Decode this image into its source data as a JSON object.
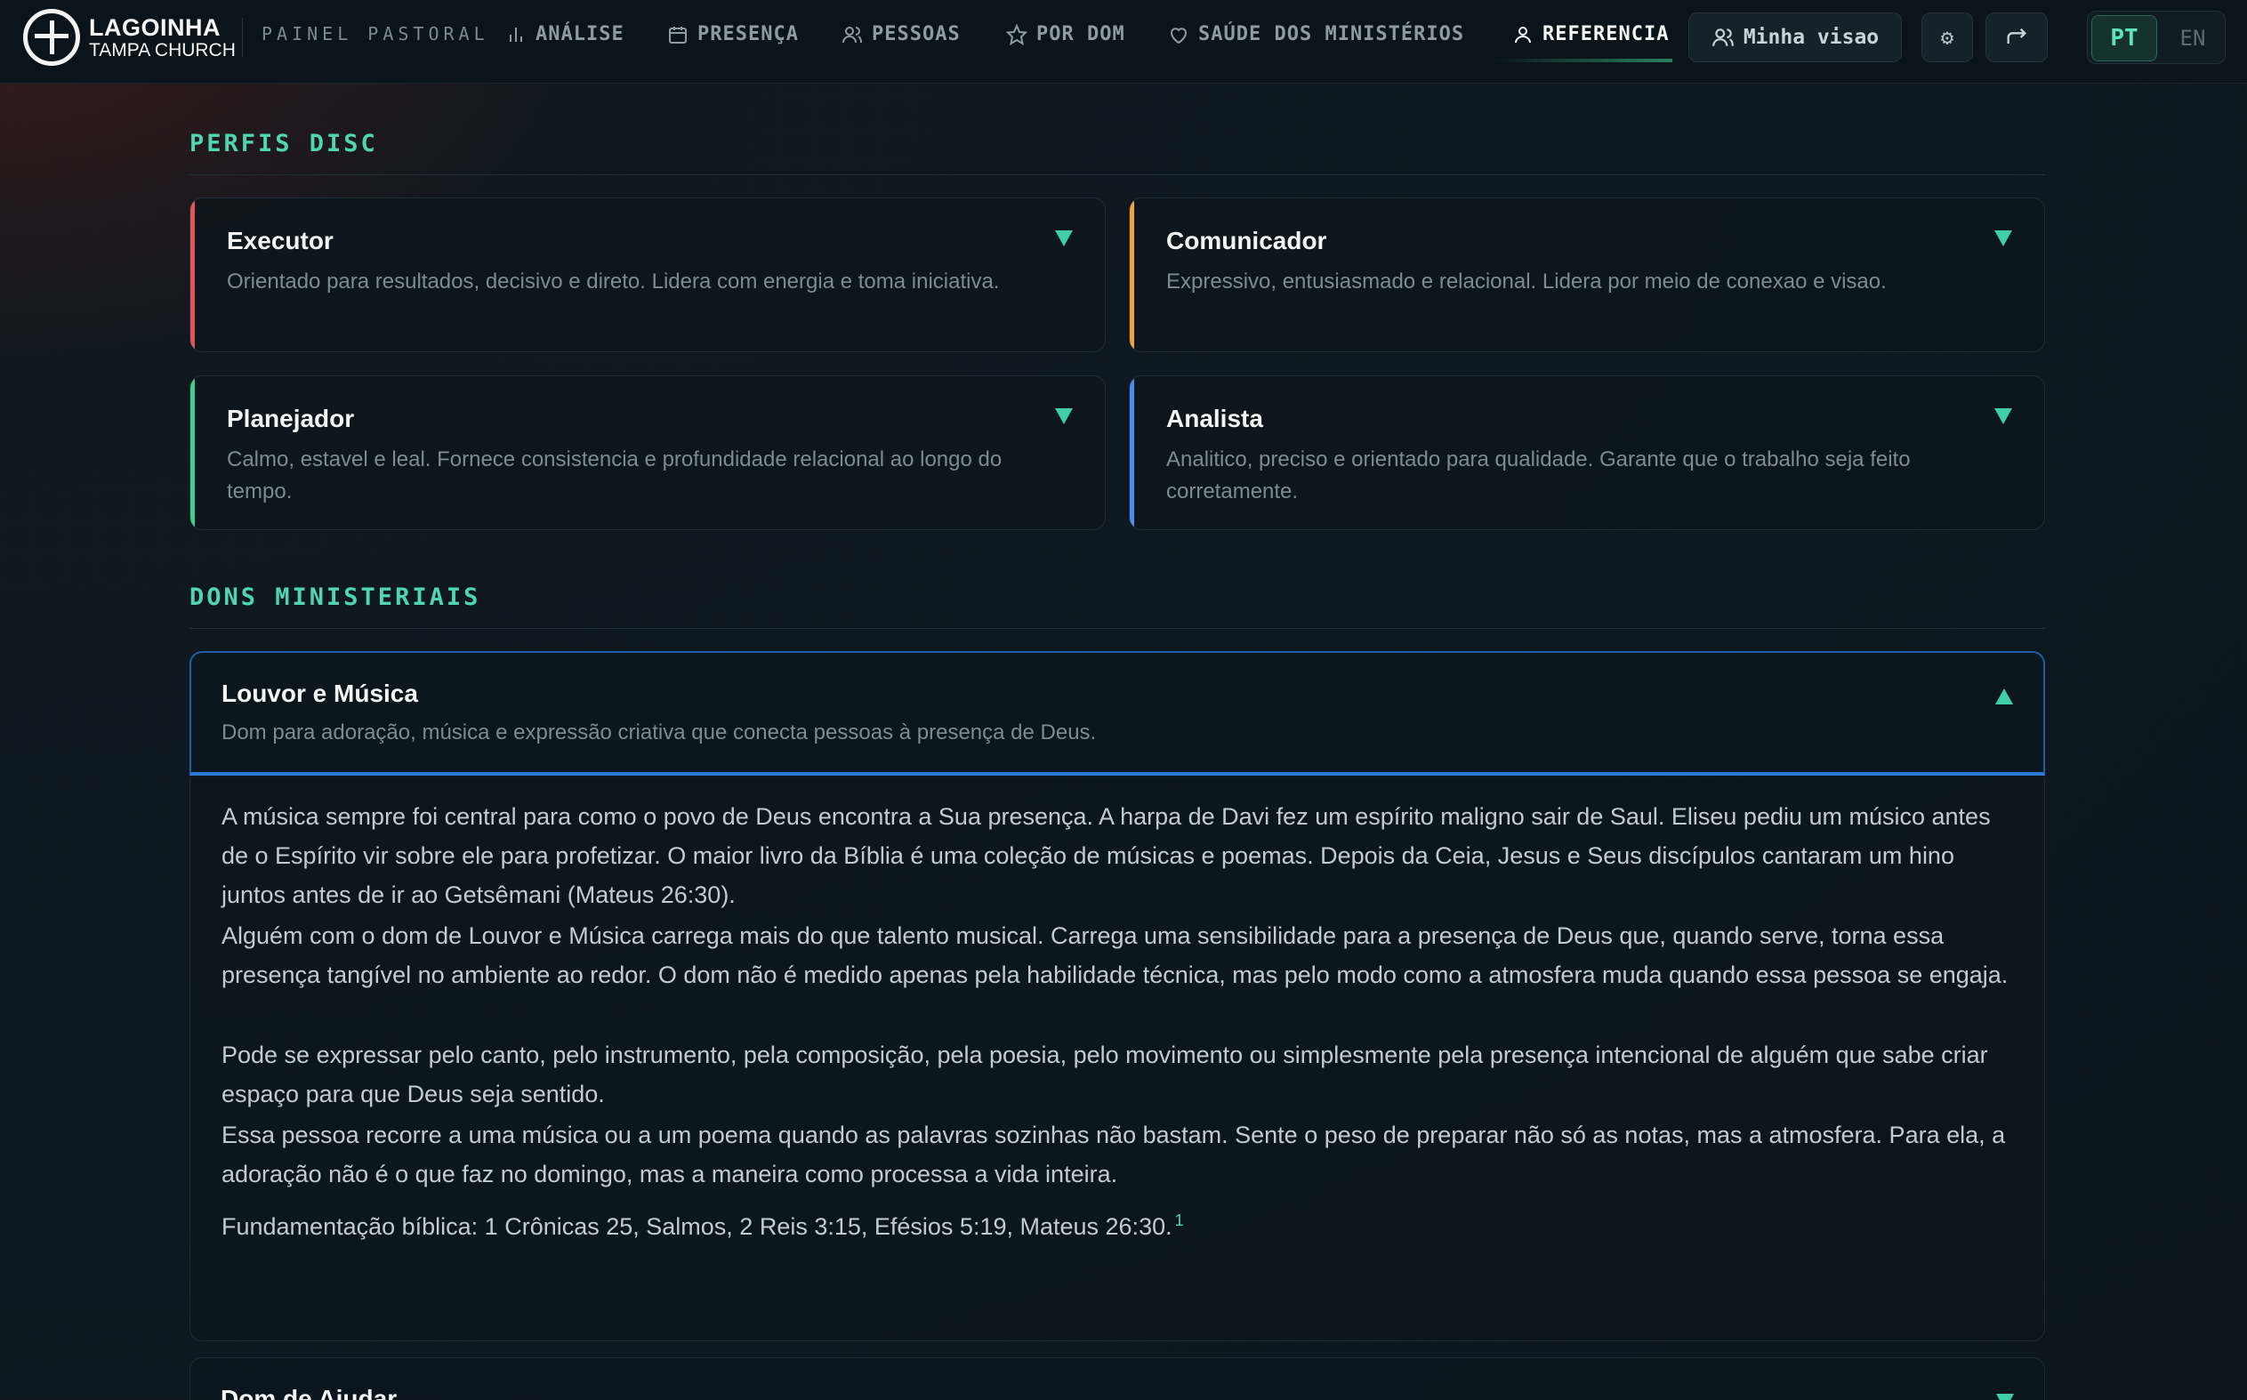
{
  "brand": {
    "name": "LAGOINHA",
    "subtitle": "TAMPA CHURCH"
  },
  "nav": {
    "panel": "PAINEL PASTORAL",
    "items": [
      {
        "label": "ANÁLISE",
        "icon": "bar-chart-icon"
      },
      {
        "label": "PRESENÇA",
        "icon": "calendar-icon"
      },
      {
        "label": "PESSOAS",
        "icon": "people-icon"
      },
      {
        "label": "POR DOM",
        "icon": "star-icon"
      },
      {
        "label": "SAÚDE DOS MINISTÉRIOS",
        "icon": "heart-icon"
      },
      {
        "label": "REFERENCIA",
        "icon": "person-icon",
        "active": true
      }
    ],
    "my_view": "Minha visao",
    "settings_icon": "gear-icon",
    "logout_icon": "logout-icon"
  },
  "lang": {
    "pt": "PT",
    "en": "EN",
    "selected": "PT"
  },
  "disc": {
    "title": "PERFIS DISC",
    "cards": [
      {
        "title": "Executor",
        "description": "Orientado para resultados, decisivo e direto. Lidera com energia e toma iniciativa.",
        "color": "#e2545a"
      },
      {
        "title": "Comunicador",
        "description": "Expressivo, entusiasmado e relacional. Lidera por meio de conexao e visao.",
        "color": "#f0a43a"
      },
      {
        "title": "Planejador",
        "description": "Calmo, estavel e leal. Fornece consistencia e profundidade relacional ao longo do tempo.",
        "color": "#3fcf8e"
      },
      {
        "title": "Analista",
        "description": "Analitico, preciso e orientado para qualidade. Garante que o trabalho seja feito corretamente.",
        "color": "#4a8ef0"
      }
    ]
  },
  "gifts": {
    "title": "DONS MINISTERIAIS",
    "open": {
      "title": "Louvor e Música",
      "description": "Dom para adoração, música e expressão criativa que conecta pessoas à presença de Deus.",
      "paragraphs": [
        "A música sempre foi central para como o povo de Deus encontra a Sua presença. A harpa de Davi fez um espírito maligno sair de Saul. Eliseu pediu um músico antes de o Espírito vir sobre ele para profetizar. O maior livro da Bíblia é uma coleção de músicas e poemas. Depois da Ceia, Jesus e Seus discípulos cantaram um hino juntos antes de ir ao Getsêmani (Mateus 26:30).",
        "Alguém com o dom de Louvor e Música carrega mais do que talento musical. Carrega uma sensibilidade para a presença de Deus que, quando serve, torna essa presença tangível no ambiente ao redor. O dom não é medido apenas pela habilidade técnica, mas pelo modo como a atmosfera muda quando essa pessoa se engaja.",
        "Pode se expressar pelo canto, pelo instrumento, pela composição, pela poesia, pelo movimento ou simplesmente pela presença intencional de alguém que sabe criar espaço para que Deus seja sentido.",
        "Essa pessoa recorre a uma música ou a um poema quando as palavras sozinhas não bastam. Sente o peso de preparar não só as notas, mas a atmosfera. Para ela, a adoração não é o que faz no domingo, mas a maneira como processa a vida inteira."
      ],
      "foundation": "Fundamentação bíblica: 1 Crônicas 25, Salmos, 2 Reis 3:15, Efésios 5:19, Mateus 26:30.",
      "footnote": "1"
    },
    "next_title": "Dom de Ajudar"
  }
}
